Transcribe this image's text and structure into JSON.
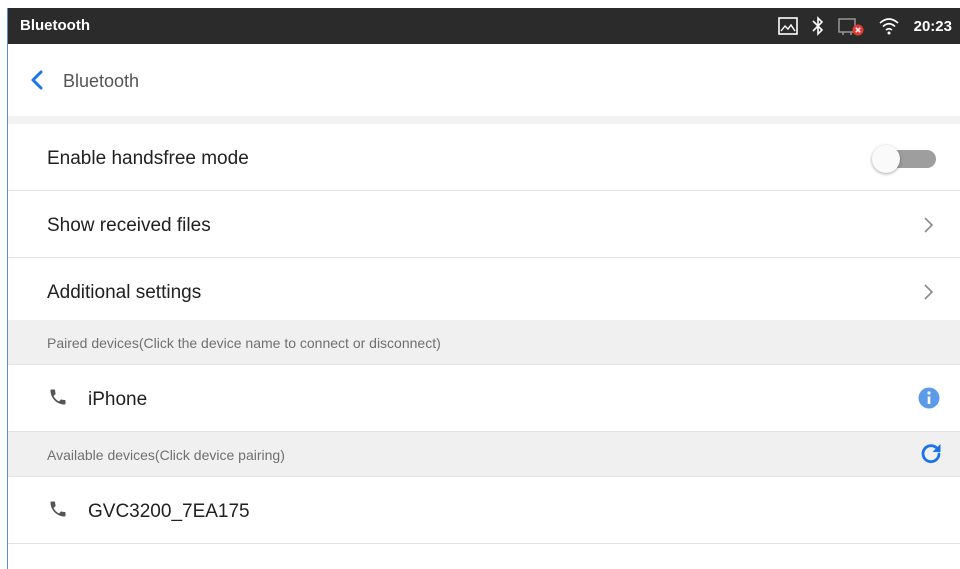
{
  "status_bar": {
    "title": "Bluetooth",
    "time": "20:23",
    "icons": [
      "screenshot-icon",
      "bluetooth-icon",
      "network-error-icon",
      "wifi-icon"
    ]
  },
  "app_bar": {
    "title": "Bluetooth",
    "back_icon": "chevron-left-icon"
  },
  "settings": {
    "handsfree": {
      "label": "Enable handsfree mode",
      "enabled": false
    },
    "received_files": {
      "label": "Show received files"
    },
    "additional": {
      "label": "Additional settings"
    }
  },
  "paired": {
    "header": "Paired devices(Click the device name to connect or disconnect)",
    "devices": [
      {
        "name": "iPhone",
        "icon": "phone-icon",
        "action_icon": "info-icon"
      }
    ]
  },
  "available": {
    "header": "Available devices(Click device pairing)",
    "refresh_icon": "refresh-icon",
    "devices": [
      {
        "name": "GVC3200_7EA175",
        "icon": "phone-icon"
      }
    ]
  },
  "colors": {
    "status_bar_bg": "#2b2b2b",
    "accent": "#1a73e8",
    "info": "#5b9bea",
    "section_bg": "#f0f0f0"
  }
}
